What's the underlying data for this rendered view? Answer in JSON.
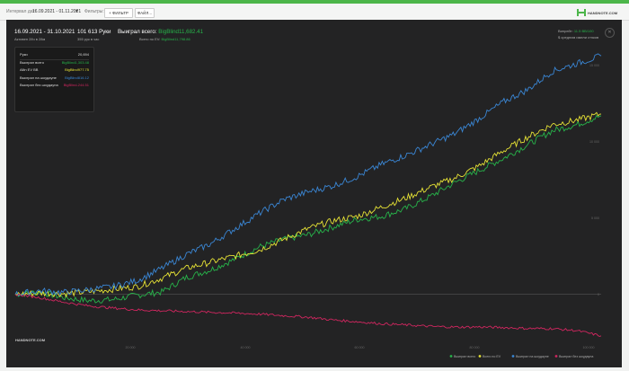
{
  "toolbar": {
    "date_label": "Интервал дат:",
    "date_value": "16.09.2021 - 01.11.2021",
    "filters_label": "Фильтры:",
    "filter_button": "+ ФИЛЬТР",
    "file_button": "ФАЙЛ...",
    "logo_text": "HANDNOTE.COM"
  },
  "header": {
    "date_range": "16.09.2021 - 31.10.2021",
    "active_days": "Активен 28ч в 28м",
    "hands": "101 613 Руки",
    "rate": "355 рук в час",
    "won_label": "Выиграл всего:",
    "won_value": "BigBlind11,682.41",
    "ev_label": "Всего по EV:",
    "ev_value": "BigBlind11,798.86",
    "winrate_label": "Винрейт:",
    "winrate_value": "11.5 BB/100",
    "avgstack": "$ средним имели стэков"
  },
  "tooltip": {
    "rows": [
      {
        "label": "Руки",
        "value": "20,694",
        "color": "#dddddd"
      },
      {
        "label": "Выиграл всего",
        "value": "BigBlind1,303.48",
        "color": "#27b34a"
      },
      {
        "label": "Allin EV BB",
        "value": "BigBlind977.75",
        "color": "#e6e235"
      },
      {
        "label": "Выиграл на шоудауне",
        "value": "BigBlind816.12",
        "color": "#3a86d4"
      },
      {
        "label": "Выиграл без шоудауна",
        "value": "BigBlind-244.51",
        "color": "#d0265f"
      }
    ]
  },
  "chart_data": {
    "type": "line",
    "x_label": "",
    "x_ticks": [
      "20 000",
      "40 000",
      "60 000",
      "80 000",
      "100 000"
    ],
    "y_ticks": [
      "15 000",
      "10 000",
      "5 000",
      "0"
    ],
    "series": [
      {
        "name": "Выиграл всего",
        "color": "#27b34a",
        "values": [
          0,
          160,
          -220,
          -420,
          -350,
          -60,
          150,
          1100,
          1600,
          2300,
          3100,
          3600,
          3900,
          4400,
          4900,
          5100,
          5600,
          6400,
          7300,
          8100,
          8900,
          9800,
          10700,
          11100,
          11682
        ]
      },
      {
        "name": "Всего по EV",
        "color": "#e6e235",
        "values": [
          0,
          80,
          40,
          160,
          320,
          500,
          1050,
          1700,
          2100,
          2500,
          2900,
          3600,
          4300,
          4800,
          5100,
          5700,
          6300,
          7000,
          7600,
          8400,
          9400,
          10300,
          11100,
          11400,
          11799
        ]
      },
      {
        "name": "Выиграл на шоудауне",
        "color": "#3a86d4",
        "values": [
          0,
          230,
          120,
          300,
          500,
          900,
          1700,
          2600,
          3300,
          4300,
          5300,
          6200,
          6700,
          7100,
          7700,
          8500,
          9100,
          9800,
          10500,
          11500,
          12600,
          13400,
          14600,
          15100,
          15600
        ]
      },
      {
        "name": "Выиграл без шоудауна",
        "color": "#d0265f",
        "values": [
          0,
          -220,
          -520,
          -760,
          -900,
          -1020,
          -1080,
          -1130,
          -1180,
          -1230,
          -1300,
          -1400,
          -1500,
          -1680,
          -1800,
          -1930,
          -2010,
          -2100,
          -2150,
          -2140,
          -2180,
          -2240,
          -2250,
          -2380,
          -2720
        ]
      }
    ],
    "ylim": [
      -3200,
      16500
    ],
    "grid": false,
    "legend_position": "bottom-right"
  }
}
